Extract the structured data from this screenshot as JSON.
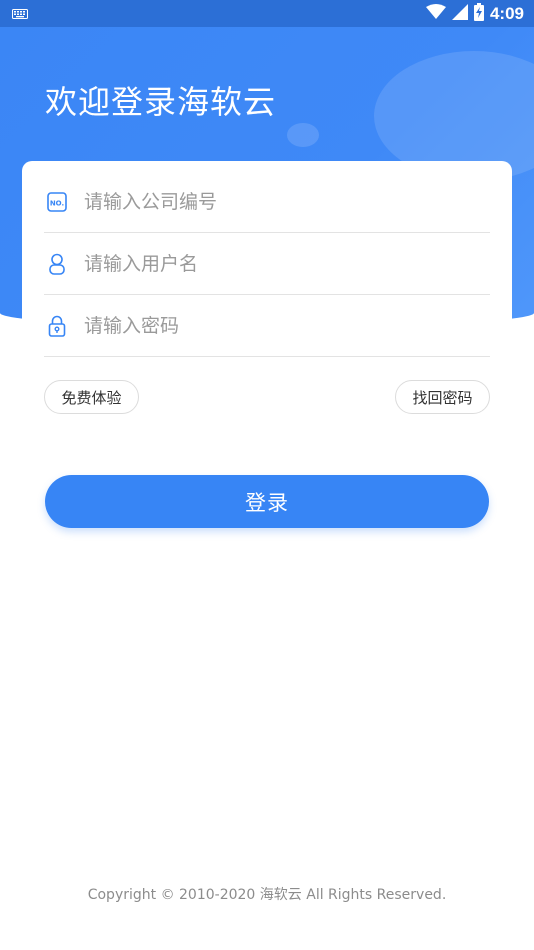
{
  "status_bar": {
    "time": "4:09",
    "icons": [
      "keyboard-icon",
      "wifi-icon",
      "signal-icon",
      "battery-charging-icon"
    ]
  },
  "header": {
    "welcome_title": "欢迎登录海软云"
  },
  "form": {
    "company_code_placeholder": "请输入公司编号",
    "company_code_icon": "no-badge-icon",
    "username_placeholder": "请输入用户名",
    "username_icon": "user-icon",
    "password_placeholder": "请输入密码",
    "password_icon": "lock-icon",
    "free_trial_label": "免费体验",
    "forgot_password_label": "找回密码",
    "login_label": "登录"
  },
  "colors": {
    "primary": "#3785f5",
    "status_bar": "#2c6fd6"
  },
  "footer": {
    "copyright": "Copyright © 2010-2020 海软云 All Rights Reserved."
  }
}
